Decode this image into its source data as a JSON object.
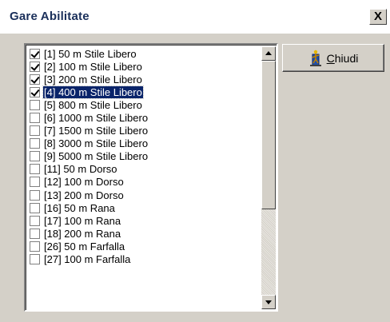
{
  "window": {
    "title": "Gare Abilitate",
    "close_glyph": "X"
  },
  "buttons": {
    "chiudi": {
      "accel": "C",
      "rest": "hiudi",
      "icon": "door-exit-icon"
    }
  },
  "list": {
    "items": [
      {
        "label": "[1] 50 m Stile Libero",
        "checked": true,
        "selected": false
      },
      {
        "label": "[2] 100 m Stile Libero",
        "checked": true,
        "selected": false
      },
      {
        "label": "[3] 200 m Stile Libero",
        "checked": true,
        "selected": false
      },
      {
        "label": "[4] 400 m Stile Libero",
        "checked": true,
        "selected": true
      },
      {
        "label": "[5] 800 m Stile Libero",
        "checked": false,
        "selected": false
      },
      {
        "label": "[6] 1000 m Stile Libero",
        "checked": false,
        "selected": false
      },
      {
        "label": "[7] 1500 m Stile Libero",
        "checked": false,
        "selected": false
      },
      {
        "label": "[8] 3000 m Stile Libero",
        "checked": false,
        "selected": false
      },
      {
        "label": "[9] 5000 m Stile Libero",
        "checked": false,
        "selected": false
      },
      {
        "label": "[11] 50 m Dorso",
        "checked": false,
        "selected": false
      },
      {
        "label": "[12] 100 m Dorso",
        "checked": false,
        "selected": false
      },
      {
        "label": "[13] 200 m Dorso",
        "checked": false,
        "selected": false
      },
      {
        "label": "[16] 50 m Rana",
        "checked": false,
        "selected": false
      },
      {
        "label": "[17] 100 m Rana",
        "checked": false,
        "selected": false
      },
      {
        "label": "[18] 200 m Rana",
        "checked": false,
        "selected": false
      },
      {
        "label": "[26] 50 m Farfalla",
        "checked": false,
        "selected": false
      },
      {
        "label": "[27] 100 m Farfalla",
        "checked": false,
        "selected": false
      }
    ]
  },
  "colors": {
    "selection": "#0a246a",
    "face": "#d4d0c8",
    "title_text": "#1a2f5a"
  }
}
